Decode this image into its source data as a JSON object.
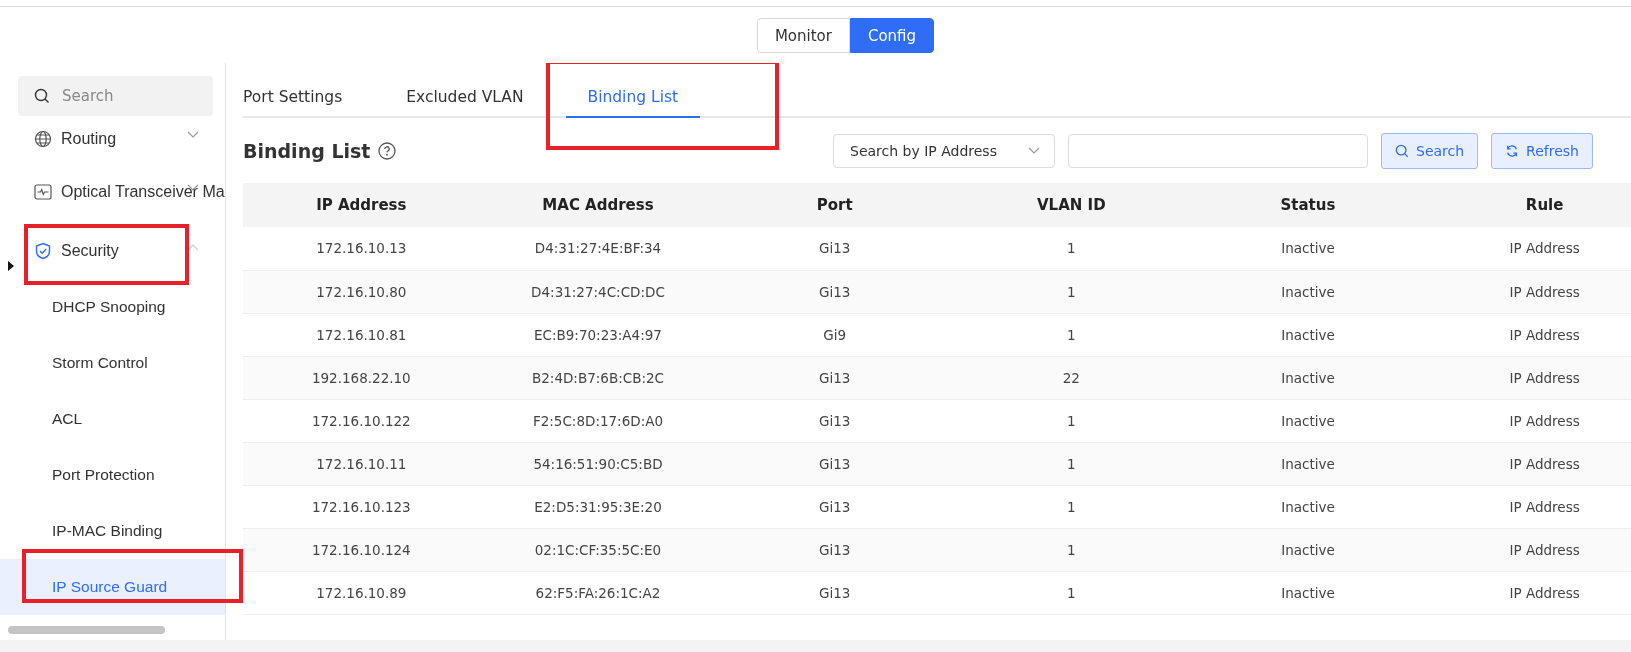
{
  "mode_switch": [
    {
      "label": "Monitor",
      "selected": false
    },
    {
      "label": "Config",
      "selected": true
    }
  ],
  "sidebar": {
    "search": {
      "placeholder": "Search"
    },
    "items": [
      {
        "label": "Routing",
        "expanded": false,
        "annotated": false
      },
      {
        "label": "Optical Transceiver Ma",
        "expanded": false,
        "annotated": false
      },
      {
        "label": "Security",
        "expanded": true,
        "annotated": true,
        "children": [
          {
            "label": "DHCP Snooping",
            "selected": false,
            "annotated": false
          },
          {
            "label": "Storm Control",
            "selected": false,
            "annotated": false
          },
          {
            "label": "ACL",
            "selected": false,
            "annotated": false
          },
          {
            "label": "Port Protection",
            "selected": false,
            "annotated": false
          },
          {
            "label": "IP-MAC Binding",
            "selected": false,
            "annotated": false
          },
          {
            "label": "IP Source Guard",
            "selected": true,
            "annotated": true
          }
        ]
      }
    ]
  },
  "tabs": [
    {
      "label": "Port Settings",
      "selected": false,
      "annotated": false
    },
    {
      "label": "Excluded VLAN",
      "selected": false,
      "annotated": false
    },
    {
      "label": "Binding List",
      "selected": true,
      "annotated": true
    }
  ],
  "section_title": "Binding List",
  "toolbar": {
    "search_type": "Search by IP Address",
    "search_button": "Search",
    "refresh_button": "Refresh"
  },
  "table": {
    "columns": [
      "IP Address",
      "MAC Address",
      "Port",
      "VLAN ID",
      "Status",
      "Rule"
    ],
    "rows": [
      [
        "172.16.10.13",
        "D4:31:27:4E:BF:34",
        "Gi13",
        "1",
        "Inactive",
        "IP Address"
      ],
      [
        "172.16.10.80",
        "D4:31:27:4C:CD:DC",
        "Gi13",
        "1",
        "Inactive",
        "IP Address"
      ],
      [
        "172.16.10.81",
        "EC:B9:70:23:A4:97",
        "Gi9",
        "1",
        "Inactive",
        "IP Address"
      ],
      [
        "192.168.22.10",
        "B2:4D:B7:6B:CB:2C",
        "Gi13",
        "22",
        "Inactive",
        "IP Address"
      ],
      [
        "172.16.10.122",
        "F2:5C:8D:17:6D:A0",
        "Gi13",
        "1",
        "Inactive",
        "IP Address"
      ],
      [
        "172.16.10.11",
        "54:16:51:90:C5:BD",
        "Gi13",
        "1",
        "Inactive",
        "IP Address"
      ],
      [
        "172.16.10.123",
        "E2:D5:31:95:3E:20",
        "Gi13",
        "1",
        "Inactive",
        "IP Address"
      ],
      [
        "172.16.10.124",
        "02:1C:CF:35:5C:E0",
        "Gi13",
        "1",
        "Inactive",
        "IP Address"
      ],
      [
        "172.16.10.89",
        "62:F5:FA:26:1C:A2",
        "Gi13",
        "1",
        "Inactive",
        "IP Address"
      ]
    ]
  }
}
